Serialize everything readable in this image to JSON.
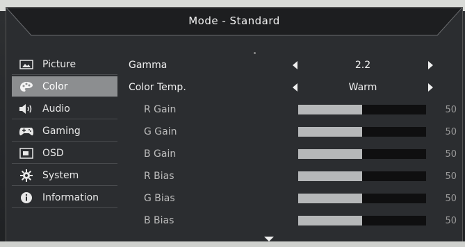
{
  "header": {
    "title": "Mode - Standard"
  },
  "sidebar": {
    "items": [
      {
        "label": "Picture",
        "icon": "picture-icon"
      },
      {
        "label": "Color",
        "icon": "palette-icon",
        "active": true
      },
      {
        "label": "Audio",
        "icon": "speaker-icon"
      },
      {
        "label": "Gaming",
        "icon": "gamepad-icon"
      },
      {
        "label": "OSD",
        "icon": "osd-icon"
      },
      {
        "label": "System",
        "icon": "gear-icon"
      },
      {
        "label": "Information",
        "icon": "info-icon"
      }
    ]
  },
  "content": {
    "gamma": {
      "label": "Gamma",
      "value": "2.2"
    },
    "color_temp": {
      "label": "Color Temp.",
      "value": "Warm"
    },
    "sliders": [
      {
        "label": "R Gain",
        "value": 50,
        "display": "50"
      },
      {
        "label": "G Gain",
        "value": 50,
        "display": "50"
      },
      {
        "label": "B Gain",
        "value": 50,
        "display": "50"
      },
      {
        "label": "R Bias",
        "value": 50,
        "display": "50"
      },
      {
        "label": "G Bias",
        "value": 50,
        "display": "50"
      },
      {
        "label": "B Bias",
        "value": 50,
        "display": "50"
      }
    ]
  },
  "colors": {
    "active_item": "#8c8e90",
    "slider_fill": "#b6b8b9",
    "slider_track": "#0f0f10"
  }
}
